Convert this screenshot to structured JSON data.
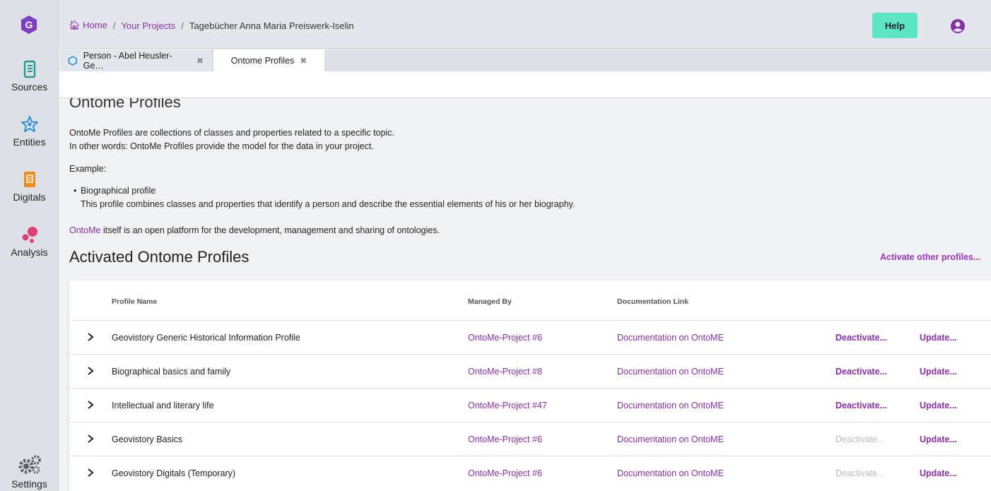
{
  "breadcrumb": {
    "home": "Home",
    "sep1": "/",
    "projects": "Your Projects",
    "sep2": "/",
    "current": "Tagebücher Anna Maria Preiswerk-Iselin"
  },
  "header": {
    "help": "Help"
  },
  "nav": {
    "sources": "Sources",
    "entities": "Entities",
    "digitals": "Digitals",
    "analysis": "Analysis",
    "settings": "Settings"
  },
  "tabs": [
    {
      "label": "Person - Abel Heusler-Ge…"
    },
    {
      "label": "Ontome Profiles"
    }
  ],
  "page": {
    "title": "Ontome Profiles",
    "intro1": "OntoMe Profiles are collections of classes and properties related to a specific topic.",
    "intro2": "In other words: OntoMe Profiles provide the model for the data in your project.",
    "example_label": "Example:",
    "bullet_title": "Biographical profile",
    "bullet_desc": "This profile combines classes and properties that identify a person and describe the essential elements of his or her biography.",
    "ontome_link": "OntoMe",
    "ontome_rest": " itself is an open platform for the development, management and sharing of ontologies.",
    "section_title": "Activated Ontome Profiles",
    "activate_other": "Activate other profiles..."
  },
  "table": {
    "headers": {
      "name": "Profile Name",
      "managed": "Managed By",
      "doc": "Documentation Link"
    },
    "rows": [
      {
        "name": "Geovistory Generic Historical Information Profile",
        "managed": "OntoMe-Project #6",
        "doc": "Documentation on OntoME",
        "deactivate": "Deactivate...",
        "deactivate_enabled": true,
        "update": "Update..."
      },
      {
        "name": "Biographical basics and family",
        "managed": "OntoMe-Project #8",
        "doc": "Documentation on OntoME",
        "deactivate": "Deactivate...",
        "deactivate_enabled": true,
        "update": "Update..."
      },
      {
        "name": "Intellectual and literary life",
        "managed": "OntoMe-Project #47",
        "doc": "Documentation on OntoME",
        "deactivate": "Deactivate...",
        "deactivate_enabled": true,
        "update": "Update..."
      },
      {
        "name": "Geovistory Basics",
        "managed": "OntoMe-Project #6",
        "doc": "Documentation on OntoME",
        "deactivate": "Deactivate...",
        "deactivate_enabled": false,
        "update": "Update..."
      },
      {
        "name": "Geovistory Digitals (Temporary)",
        "managed": "OntoMe-Project #6",
        "doc": "Documentation on OntoME",
        "deactivate": "Deactivate...",
        "deactivate_enabled": false,
        "update": "Update..."
      }
    ]
  },
  "colors": {
    "accent": "#8a2ea8",
    "help_button": "#5ee6c4",
    "logo": "#7b3fbf",
    "sources_icon": "#1f9e8f",
    "entities_icon": "#2a8fd6",
    "digitals_icon": "#f08a1c",
    "analysis_icon": "#e0407a"
  },
  "icons": {
    "logo": "geovistory-logo",
    "home": "home-icon",
    "user": "user-circle-icon",
    "sources": "scroll-icon",
    "entities": "star-network-icon",
    "digitals": "document-icon",
    "analysis": "analysis-icon",
    "settings": "gears-icon",
    "tab_entity": "hexagon-icon",
    "close": "close-icon",
    "expand": "chevron-right-icon"
  }
}
